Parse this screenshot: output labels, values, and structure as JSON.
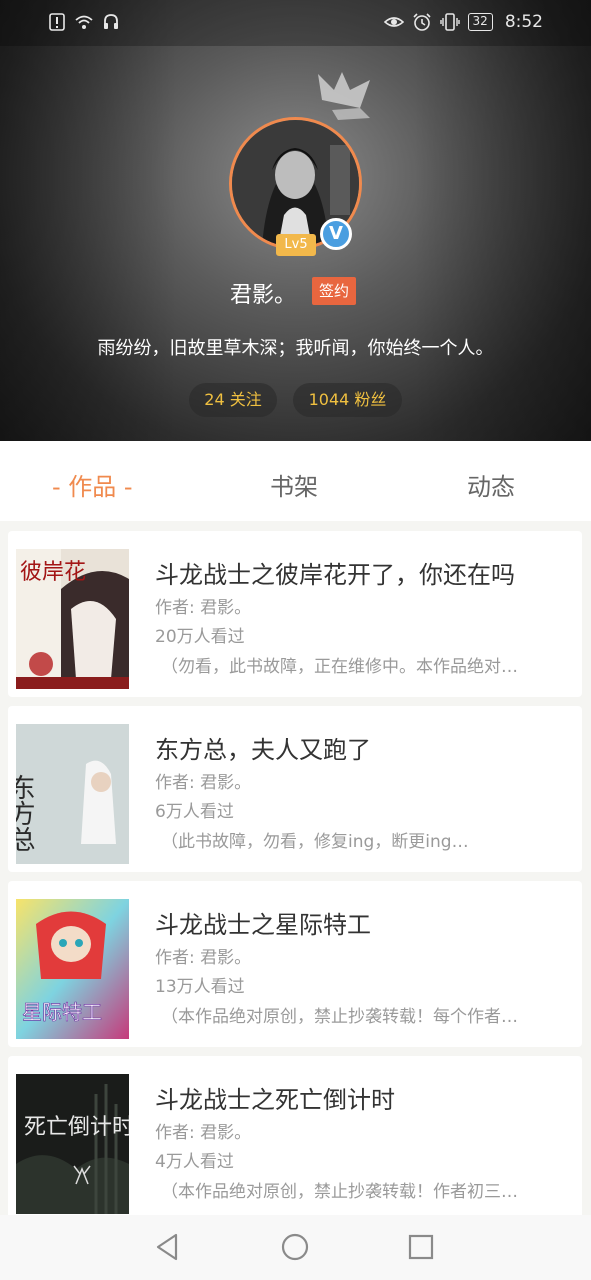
{
  "status_bar": {
    "battery": "32",
    "time": "8:52",
    "left_icons": [
      "alert-icon",
      "wifi-icon",
      "headset-icon"
    ],
    "right_icons": [
      "eye-icon",
      "alarm-icon",
      "vibrate-icon",
      "battery-icon"
    ]
  },
  "profile": {
    "level": "Lv5",
    "verified_mark": "V",
    "username": "君影。",
    "sign_badge": "签约",
    "motto": "雨纷纷，旧故里草木深；我听闻，你始终一个人。",
    "following": "24 关注",
    "fans": "1044 粉丝"
  },
  "tabs": [
    {
      "label": "- 作品 -",
      "active": true
    },
    {
      "label": "书架",
      "active": false
    },
    {
      "label": "动态",
      "active": false
    }
  ],
  "books": [
    {
      "title": "斗龙战士之彼岸花开了，你还在吗",
      "author": "作者: 君影。",
      "views": "20万人看过",
      "desc": "（勿看，此书故障，正在维修中。本作品绝对…",
      "cover_text": "彼岸花"
    },
    {
      "title": "东方总，夫人又跑了",
      "author": "作者: 君影。",
      "views": "6万人看过",
      "desc": "（此书故障，勿看，修复ing，断更ing…",
      "cover_text": "东方总"
    },
    {
      "title": "斗龙战士之星际特工",
      "author": "作者: 君影。",
      "views": "13万人看过",
      "desc": "（本作品绝对原创，禁止抄袭转载！每个作者…",
      "cover_text": "星际特工"
    },
    {
      "title": "斗龙战士之死亡倒计时",
      "author": "作者: 君影。",
      "views": "4万人看过",
      "desc": "（本作品绝对原创，禁止抄袭转载！作者初三…",
      "cover_text": "死亡倒计时"
    }
  ],
  "colors": {
    "accent": "#f08a4e",
    "gold": "#f0c040",
    "sign": "#e8663f",
    "verified": "#4a9ee0"
  }
}
